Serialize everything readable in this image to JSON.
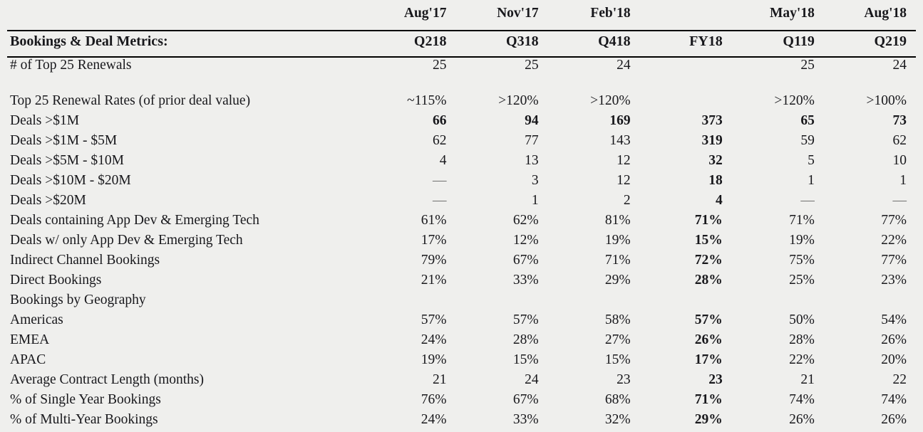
{
  "table": {
    "section_title": "Bookings & Deal Metrics:",
    "date_headers": [
      "Aug'17",
      "Nov'17",
      "Feb'18",
      "",
      "May'18",
      "Aug'18"
    ],
    "period_headers": [
      "Q218",
      "Q318",
      "Q418",
      "FY18",
      "Q119",
      "Q219"
    ],
    "emphasis_column_index": 3,
    "dash": "—",
    "rows": [
      {
        "label": "# of Top 25 Renewals",
        "indent": 0,
        "bold_label": false,
        "values": [
          "25",
          "25",
          "24",
          "",
          "25",
          "24"
        ]
      },
      {
        "label": "",
        "indent": 0,
        "spacer": true,
        "values": [
          "",
          "",
          "",
          "",
          "",
          ""
        ]
      },
      {
        "label": "Top 25 Renewal Rates (of prior deal value)",
        "indent": 0,
        "values": [
          "~115%",
          ">120%",
          ">120%",
          "",
          ">120%",
          ">100%"
        ]
      },
      {
        "label": "Deals >$1M",
        "indent": 0,
        "bold_values": true,
        "values": [
          "66",
          "94",
          "169",
          "373",
          "65",
          "73"
        ]
      },
      {
        "label": "Deals >$1M - $5M",
        "indent": 1,
        "values": [
          "62",
          "77",
          "143",
          "319",
          "59",
          "62"
        ]
      },
      {
        "label": "Deals >$5M - $10M",
        "indent": 1,
        "values": [
          "4",
          "13",
          "12",
          "32",
          "5",
          "10"
        ]
      },
      {
        "label": "Deals >$10M - $20M",
        "indent": 1,
        "values": [
          "—",
          "3",
          "12",
          "18",
          "1",
          "1"
        ]
      },
      {
        "label": "Deals >$20M",
        "indent": 1,
        "values": [
          "—",
          "1",
          "2",
          "4",
          "—",
          "—"
        ]
      },
      {
        "label": "Deals containing App Dev & Emerging Tech",
        "indent": 0,
        "values": [
          "61%",
          "62%",
          "81%",
          "71%",
          "71%",
          "77%"
        ]
      },
      {
        "label": "Deals w/ only App Dev & Emerging Tech",
        "indent": 0,
        "values": [
          "17%",
          "12%",
          "19%",
          "15%",
          "19%",
          "22%"
        ]
      },
      {
        "label": "Indirect Channel Bookings",
        "indent": 0,
        "values": [
          "79%",
          "67%",
          "71%",
          "72%",
          "75%",
          "77%"
        ]
      },
      {
        "label": "Direct Bookings",
        "indent": 0,
        "values": [
          "21%",
          "33%",
          "29%",
          "28%",
          "25%",
          "23%"
        ]
      },
      {
        "label": "Bookings by Geography",
        "indent": 0,
        "values": [
          "",
          "",
          "",
          "",
          "",
          ""
        ]
      },
      {
        "label": "Americas",
        "indent": 2,
        "values": [
          "57%",
          "57%",
          "58%",
          "57%",
          "50%",
          "54%"
        ]
      },
      {
        "label": "EMEA",
        "indent": 2,
        "values": [
          "24%",
          "28%",
          "27%",
          "26%",
          "28%",
          "26%"
        ]
      },
      {
        "label": "APAC",
        "indent": 2,
        "values": [
          "19%",
          "15%",
          "15%",
          "17%",
          "22%",
          "20%"
        ]
      },
      {
        "label": "Average Contract Length (months)",
        "indent": 0,
        "values": [
          "21",
          "24",
          "23",
          "23",
          "21",
          "22"
        ]
      },
      {
        "label": "% of Single Year Bookings",
        "indent": 0,
        "values": [
          "76%",
          "67%",
          "68%",
          "71%",
          "74%",
          "74%"
        ]
      },
      {
        "label": "% of Multi-Year Bookings",
        "indent": 0,
        "values": [
          "24%",
          "33%",
          "32%",
          "29%",
          "26%",
          "26%"
        ]
      }
    ]
  }
}
